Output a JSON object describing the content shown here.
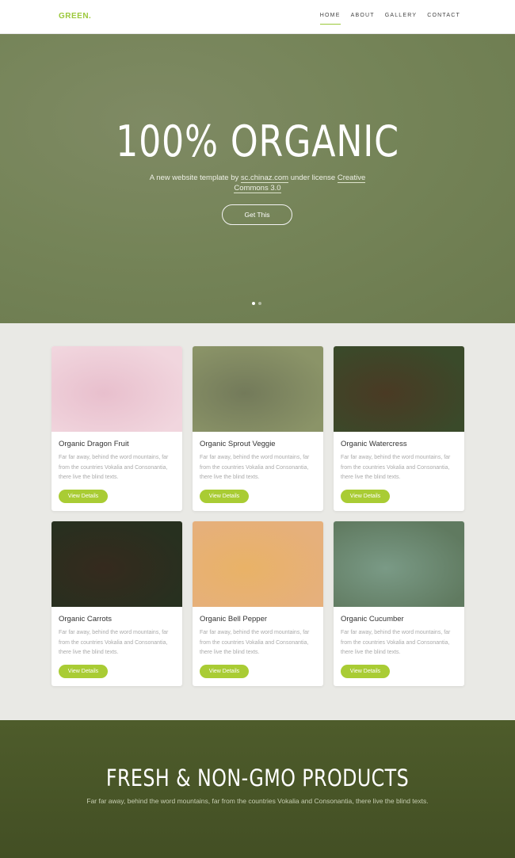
{
  "nav": {
    "brand": "GREEN.",
    "items": [
      {
        "label": "HOME",
        "active": true
      },
      {
        "label": "ABOUT",
        "active": false
      },
      {
        "label": "GALLERY",
        "active": false
      },
      {
        "label": "CONTACT",
        "active": false
      }
    ]
  },
  "hero": {
    "title": "100% ORGANIC",
    "subtitle_prefix": "A new website template by ",
    "subtitle_link1": "sc.chinaz.com",
    "subtitle_mid": " under license ",
    "subtitle_link2": "Creative Commons 3.0",
    "button": "Get This",
    "slides": 2,
    "active_slide": 1
  },
  "products": [
    {
      "title": "Organic Dragon Fruit",
      "text": "Far far away, behind the word mountains, far from the countries Vokalia and Consonantia, there live the blind texts.",
      "button": "View Details",
      "colors": [
        "#f1d6de",
        "#e8bfcd"
      ]
    },
    {
      "title": "Organic Sprout Veggie",
      "text": "Far far away, behind the word mountains, far from the countries Vokalia and Consonantia, there live the blind texts.",
      "button": "View Details",
      "colors": [
        "#8b9468",
        "#737a5a"
      ]
    },
    {
      "title": "Organic Watercress",
      "text": "Far far away, behind the word mountains, far from the countries Vokalia and Consonantia, there live the blind texts.",
      "button": "View Details",
      "colors": [
        "#3a4a2a",
        "#4a3a24"
      ]
    },
    {
      "title": "Organic Carrots",
      "text": "Far far away, behind the word mountains, far from the countries Vokalia and Consonantia, there live the blind texts.",
      "button": "View Details",
      "colors": [
        "#27301f",
        "#352a1e"
      ]
    },
    {
      "title": "Organic Bell Pepper",
      "text": "Far far away, behind the word mountains, far from the countries Vokalia and Consonantia, there live the blind texts.",
      "button": "View Details",
      "colors": [
        "#e6b07c",
        "#e9b267"
      ]
    },
    {
      "title": "Organic Cucumber",
      "text": "Far far away, behind the word mountains, far from the countries Vokalia and Consonantia, there live the blind texts.",
      "button": "View Details",
      "colors": [
        "#607a60",
        "#7a9a86"
      ]
    }
  ],
  "band": {
    "title": "FRESH & NON-GMO PRODUCTS",
    "subtitle": "Far far away, behind the word mountains, far from the countries Vokalia and Consonantia, there live the blind texts."
  },
  "colors": {
    "accent": "#a9cc34",
    "brand": "#9bc83a"
  }
}
